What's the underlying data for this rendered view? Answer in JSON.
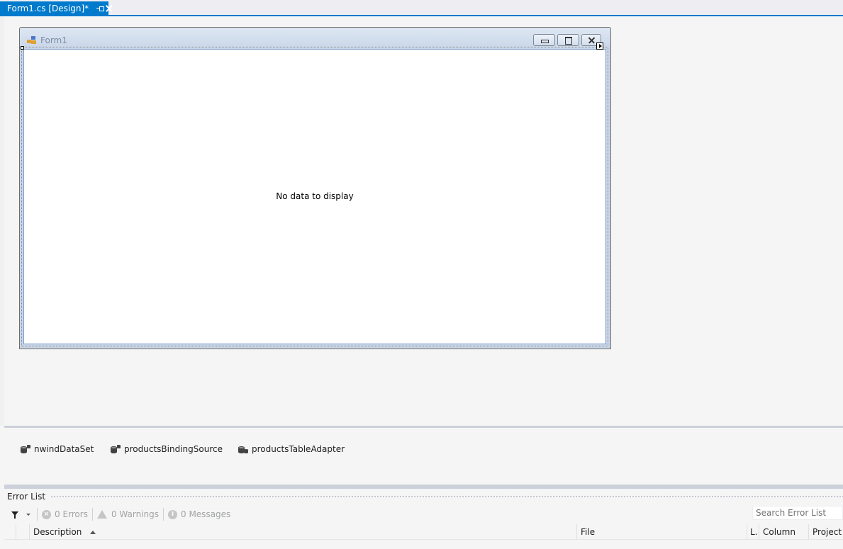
{
  "document_tab": {
    "title": "Form1.cs [Design]*",
    "pin_icon": "pin-icon",
    "close_icon": "close-icon"
  },
  "form": {
    "title": "Form1",
    "app_icon": "form-app-icon",
    "caption_buttons": [
      "minimize-icon",
      "maximize-icon",
      "close-icon"
    ]
  },
  "grid": {
    "empty_text": "No data to display"
  },
  "component_tray": {
    "items": [
      {
        "label": "nwindDataSet",
        "icon": "dataset-icon"
      },
      {
        "label": "productsBindingSource",
        "icon": "binding-source-icon"
      },
      {
        "label": "productsTableAdapter",
        "icon": "table-adapter-icon"
      }
    ]
  },
  "error_list": {
    "title": "Error List",
    "errors_label": "0 Errors",
    "warnings_label": "0 Warnings",
    "messages_label": "0 Messages",
    "search_placeholder": "Search Error List",
    "columns": [
      "Description",
      "File",
      "L.",
      "Column",
      "Project"
    ],
    "sort_column": "Description",
    "sort_direction": "ascending"
  },
  "colors": {
    "accent": "#007acc",
    "surface": "#f5f5f5",
    "form_caption": "#dee7f3"
  }
}
